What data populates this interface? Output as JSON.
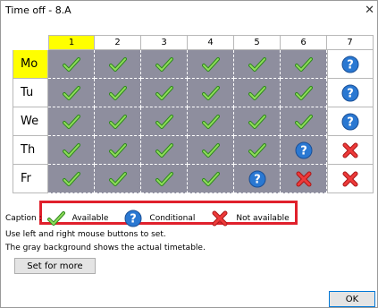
{
  "window": {
    "title": "Time off - 8.A",
    "close_glyph": "✕"
  },
  "columns": [
    {
      "label": "1",
      "active": true
    },
    {
      "label": "2",
      "active": false
    },
    {
      "label": "3",
      "active": false
    },
    {
      "label": "4",
      "active": false
    },
    {
      "label": "5",
      "active": false
    },
    {
      "label": "6",
      "active": false
    },
    {
      "label": "7",
      "active": false
    }
  ],
  "rows": [
    {
      "label": "Mo",
      "active": true,
      "cells": [
        "available",
        "available",
        "available",
        "available",
        "available",
        "available",
        "conditional"
      ]
    },
    {
      "label": "Tu",
      "active": false,
      "cells": [
        "available",
        "available",
        "available",
        "available",
        "available",
        "available",
        "conditional"
      ]
    },
    {
      "label": "We",
      "active": false,
      "cells": [
        "available",
        "available",
        "available",
        "available",
        "available",
        "available",
        "conditional"
      ]
    },
    {
      "label": "Th",
      "active": false,
      "cells": [
        "available",
        "available",
        "available",
        "available",
        "available",
        "conditional",
        "not-available"
      ]
    },
    {
      "label": "Fr",
      "active": false,
      "cells": [
        "available",
        "available",
        "available",
        "available",
        "conditional",
        "not-available",
        "not-available"
      ]
    }
  ],
  "timetable_gray_columns": 6,
  "caption": {
    "label": "Caption :",
    "available": "Available",
    "conditional": "Conditional",
    "not_available": "Not available"
  },
  "info": {
    "line1": "Use left and right mouse buttons to set.",
    "line2": "The gray background shows the actual timetable."
  },
  "buttons": {
    "set_for_more": "Set for more",
    "ok": "OK"
  },
  "colors": {
    "highlight": "#ffff00",
    "timetable_gray": "#8e8e9e",
    "annotation_red": "#e0202c"
  }
}
